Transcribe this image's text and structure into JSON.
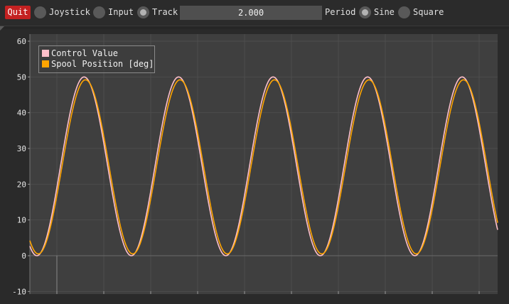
{
  "toolbar": {
    "quit_label": "Quit",
    "modes": [
      {
        "label": "Joystick",
        "selected": false
      },
      {
        "label": "Input",
        "selected": false
      },
      {
        "label": "Track",
        "selected": true
      }
    ],
    "period_value": "2.000",
    "period_label": "Period",
    "waves": [
      {
        "label": "Sine",
        "selected": true
      },
      {
        "label": "Square",
        "selected": false
      }
    ]
  },
  "colors": {
    "quit": "#c42121",
    "control": "#ffc0cb",
    "spool": "#ffa500",
    "plot_bg": "#3f3f3f"
  },
  "chart_data": {
    "type": "line",
    "title": "",
    "xlabel": "",
    "ylabel": "",
    "ylim": [
      -10,
      60
    ],
    "yticks": [
      60,
      50,
      40,
      30,
      20,
      10,
      0,
      -10
    ],
    "grid": true,
    "legend_placement": "top-left",
    "series": [
      {
        "name": "Control Value",
        "color": "#ffc0cb",
        "form": "sine",
        "min": 0,
        "max": 50,
        "cycles": 5,
        "start_value": 1.5,
        "first_peak_x": 0.116
      },
      {
        "name": "Spool Position [deg]",
        "color": "#ffa500",
        "form": "sine",
        "min": 0.5,
        "max": 49.2,
        "cycles": 5,
        "start_value": 2.0,
        "first_peak_x": 0.119
      }
    ]
  }
}
